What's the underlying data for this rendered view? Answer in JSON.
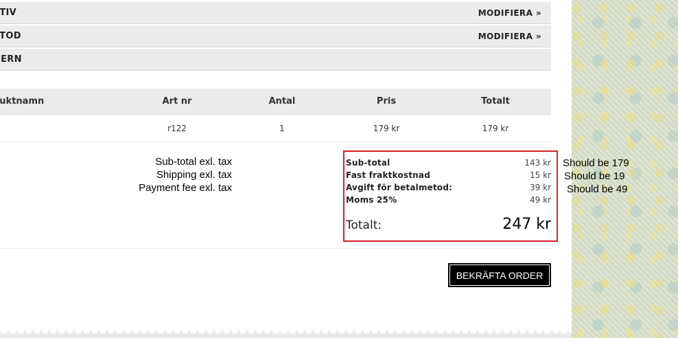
{
  "steps": [
    {
      "title": "ATIV",
      "action": "MODIFIERA »"
    },
    {
      "title": "ETOD",
      "action": "MODIFIERA »"
    },
    {
      "title": "DERN",
      "action": ""
    }
  ],
  "table": {
    "headers": [
      "duktnamn",
      "Art nr",
      "Antal",
      "Pris",
      "Totalt"
    ],
    "rows": [
      [
        "",
        "r122",
        "1",
        "179 kr",
        "179 kr"
      ]
    ]
  },
  "annotations_left": [
    "Sub-total exl. tax",
    "Shipping exl. tax",
    "Payment fee exl. tax"
  ],
  "totals": {
    "lines": [
      {
        "label": "Sub-total",
        "value": "143 kr"
      },
      {
        "label": "Fast fraktkostnad",
        "value": "15 kr"
      },
      {
        "label": "Avgift för betalmetod:",
        "value": "39 kr"
      },
      {
        "label": "Moms 25%",
        "value": "49 kr"
      }
    ],
    "grand_label": "Totalt:",
    "grand_value": "247 kr",
    "highlight_color": "#d42027"
  },
  "annotations_right": [
    "Should be 179",
    "Should be 19",
    "Should be 49"
  ],
  "confirm_button": "BEKRÄFTA ORDER"
}
